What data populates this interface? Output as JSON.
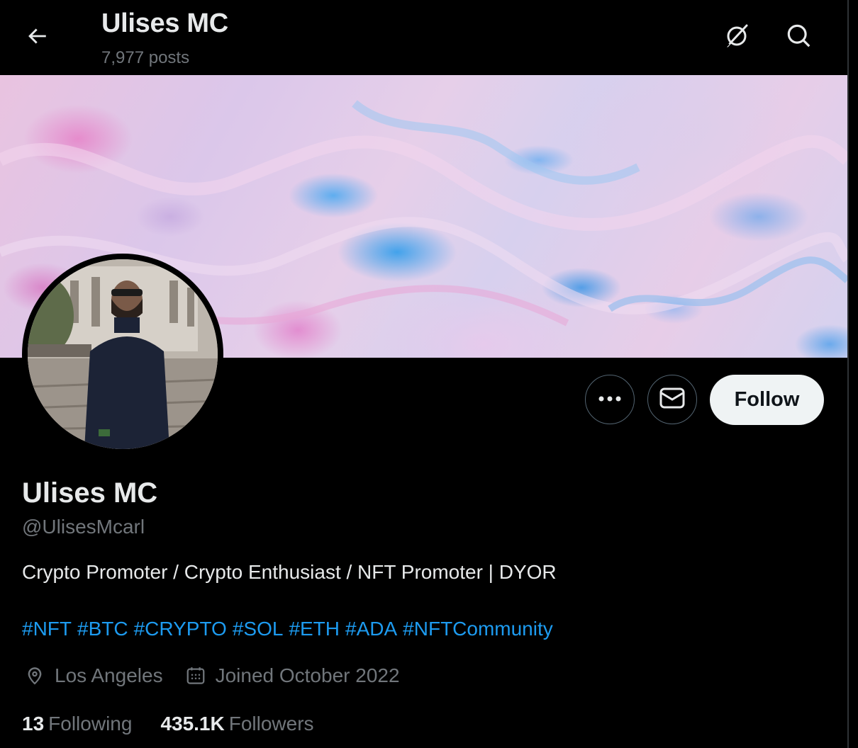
{
  "header": {
    "title": "Ulises MC",
    "posts_count": "7,977 posts",
    "back_icon": "arrow-left-icon",
    "grok_icon": "grok-icon",
    "search_icon": "search-icon"
  },
  "profile": {
    "display_name": "Ulises MC",
    "handle": "@UlisesMcarl",
    "bio": "Crypto Promoter / Crypto Enthusiast / NFT Promoter | DYOR",
    "hashtags": [
      "#NFT",
      "#BTC",
      "#CRYPTO",
      "#SOL",
      "#ETH",
      "#ADA",
      "#NFTCommunity"
    ],
    "location": "Los Angeles",
    "joined": "Joined October 2022",
    "following_count": "13",
    "following_label": "Following",
    "followers_count": "435.1K",
    "followers_label": "Followers"
  },
  "actions": {
    "more_icon": "more-icon",
    "message_icon": "mail-icon",
    "follow_label": "Follow"
  },
  "colors": {
    "background": "#000000",
    "text_primary": "#e7e9ea",
    "text_secondary": "#71767b",
    "link": "#1d9bf0",
    "follow_bg": "#eff3f4",
    "border": "#536471"
  }
}
